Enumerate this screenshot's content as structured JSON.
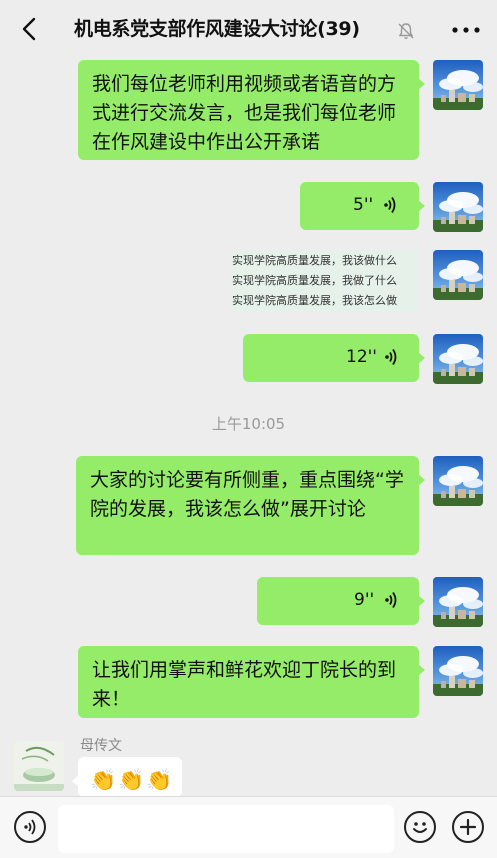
{
  "header": {
    "title": "机电系党支部作风建设大讨论(39)"
  },
  "messages": {
    "m1_text": "我们每位老师利用视频或者语音的方式进行交流发言，也是我们每位老师在作风建设中作出公开承诺",
    "m2_duration": "5''",
    "m3_image_lines": [
      "实现学院高质量发展，我该做什么",
      "实现学院高质量发展，我做了什么",
      "实现学院高质量发展，我该怎么做"
    ],
    "m4_duration": "12''",
    "timestamp": "上午10:05",
    "m5_text": "大家的讨论要有所侧重，重点围绕“学院的发展，我该怎么做”展开讨论",
    "m6_duration": "9''",
    "m7_text": "让我们用掌声和鲜花欢迎丁院长的到来！",
    "other_sender": "母传文",
    "other_emoji": "👏👏👏"
  },
  "input": {
    "placeholder": ""
  },
  "icons": {
    "back": "chevron-left-icon",
    "mute": "bell-muted-icon",
    "more": "more-dots-icon",
    "voice": "voice-wave-icon",
    "emoji": "smiley-icon",
    "add": "plus-icon"
  },
  "colors": {
    "background": "#ededed",
    "own_bubble": "#95ec69",
    "other_bubble": "#ffffff"
  }
}
